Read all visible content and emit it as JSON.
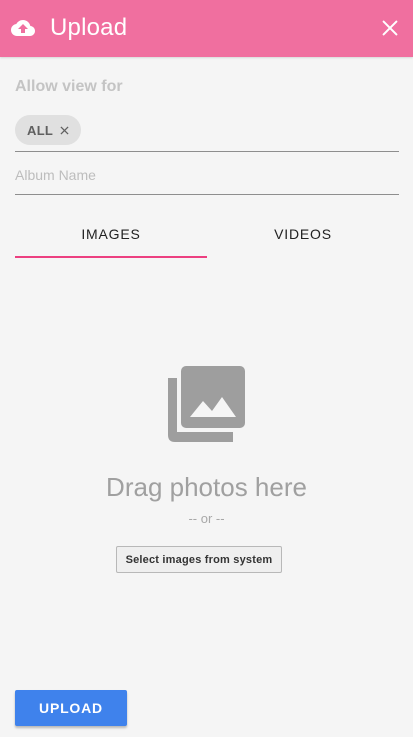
{
  "header": {
    "title": "Upload",
    "icon": "cloud-upload-icon",
    "close_icon": "close-icon",
    "background_color": "#f06f9f"
  },
  "visibility": {
    "label": "Allow view for",
    "chips": [
      {
        "label": "ALL",
        "remove_icon": "close-icon"
      }
    ]
  },
  "album": {
    "placeholder": "Album Name",
    "value": ""
  },
  "tabs": {
    "items": [
      {
        "label": "IMAGES",
        "active": true
      },
      {
        "label": "VIDEOS",
        "active": false
      }
    ],
    "indicator_color": "#ec3f80"
  },
  "dropzone": {
    "icon": "photo-library-icon",
    "title": "Drag photos here",
    "or_text": "-- or --",
    "select_button": "Select images from system"
  },
  "footer": {
    "upload_button": "UPLOAD",
    "upload_button_color": "#3f82ec"
  }
}
